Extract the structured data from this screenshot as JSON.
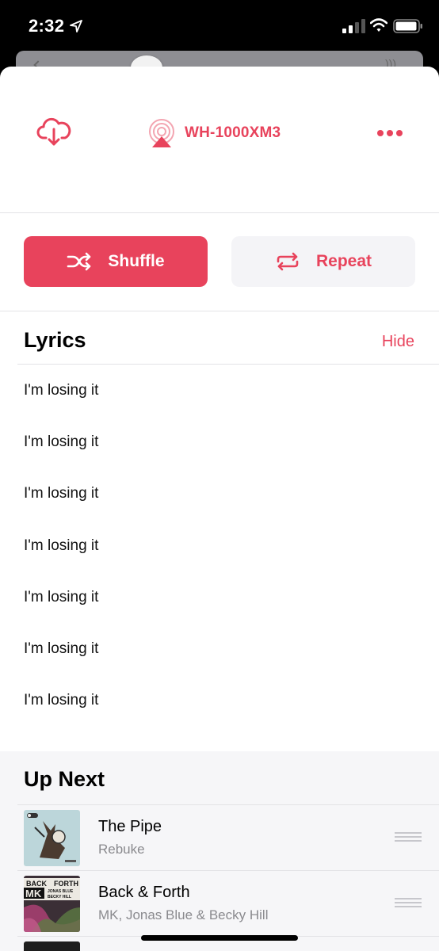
{
  "status_bar": {
    "time": "2:32"
  },
  "top_controls": {
    "device_name": "WH-1000XM3"
  },
  "buttons": {
    "shuffle_label": "Shuffle",
    "repeat_label": "Repeat"
  },
  "lyrics": {
    "title": "Lyrics",
    "hide_label": "Hide",
    "lines": [
      "I'm losing it",
      "I'm losing it",
      "I'm losing it",
      "I'm losing it",
      "I'm losing it",
      "I'm losing it",
      "I'm losing it"
    ]
  },
  "up_next": {
    "title": "Up Next",
    "tracks": [
      {
        "title": "The Pipe",
        "artist": "Rebuke",
        "art": "album-art-the-pipe"
      },
      {
        "title": "Back & Forth",
        "artist": "MK, Jonas Blue & Becky Hill",
        "art": "album-art-back-forth",
        "art_text": [
          "BACK",
          "FORTH",
          "MK",
          "JONAS BLUE",
          "BECKY HILL"
        ]
      }
    ]
  },
  "colors": {
    "accent": "#e8435c",
    "secondary_button_bg": "#f4f4f7",
    "subtitle": "#8a8a8e"
  },
  "icons": [
    "location-arrow-icon",
    "cellular-signal-icon",
    "wifi-icon",
    "battery-icon",
    "download-cloud-icon",
    "airplay-icon",
    "more-icon",
    "shuffle-icon",
    "repeat-icon",
    "drag-handle-icon"
  ]
}
